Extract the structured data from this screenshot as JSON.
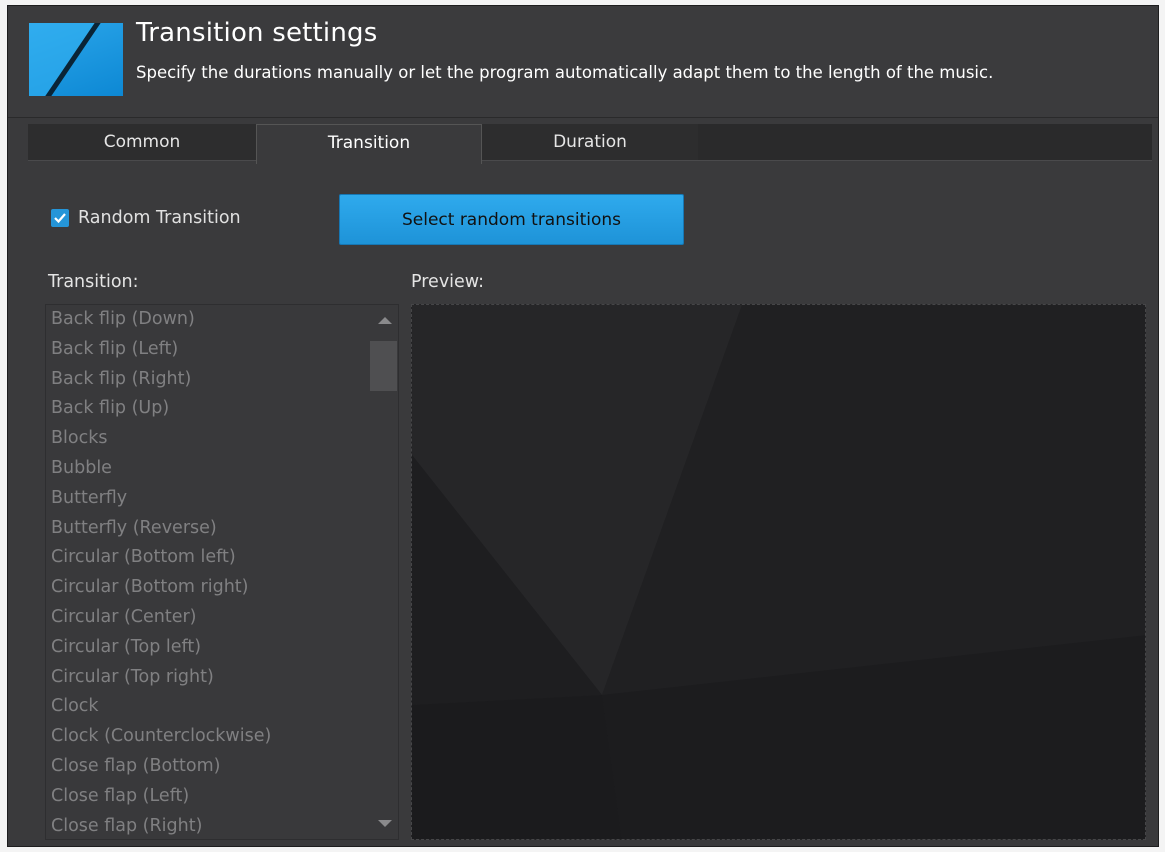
{
  "header": {
    "title": "Transition settings",
    "subtitle": "Specify the durations manually or let the program automatically adapt them to the length of the music."
  },
  "tabs": [
    {
      "label": "Common",
      "active": false
    },
    {
      "label": "Transition",
      "active": true
    },
    {
      "label": "Duration",
      "active": false
    }
  ],
  "random_transition": {
    "label": "Random Transition",
    "checked": true
  },
  "select_button": {
    "label": "Select random transitions"
  },
  "transition_list": {
    "label": "Transition:",
    "items": [
      "Back flip (Down)",
      "Back flip (Left)",
      "Back flip (Right)",
      "Back flip (Up)",
      "Blocks",
      "Bubble",
      "Butterfly",
      "Butterfly (Reverse)",
      "Circular (Bottom left)",
      "Circular (Bottom right)",
      "Circular (Center)",
      "Circular (Top left)",
      "Circular (Top right)",
      "Clock",
      "Clock (Counterclockwise)",
      "Close flap (Bottom)",
      "Close flap (Left)",
      "Close flap (Right)"
    ]
  },
  "preview": {
    "label": "Preview:"
  },
  "colors": {
    "accent": "#1e93d8",
    "background": "#3a3a3c",
    "disabled_text": "#808082"
  }
}
